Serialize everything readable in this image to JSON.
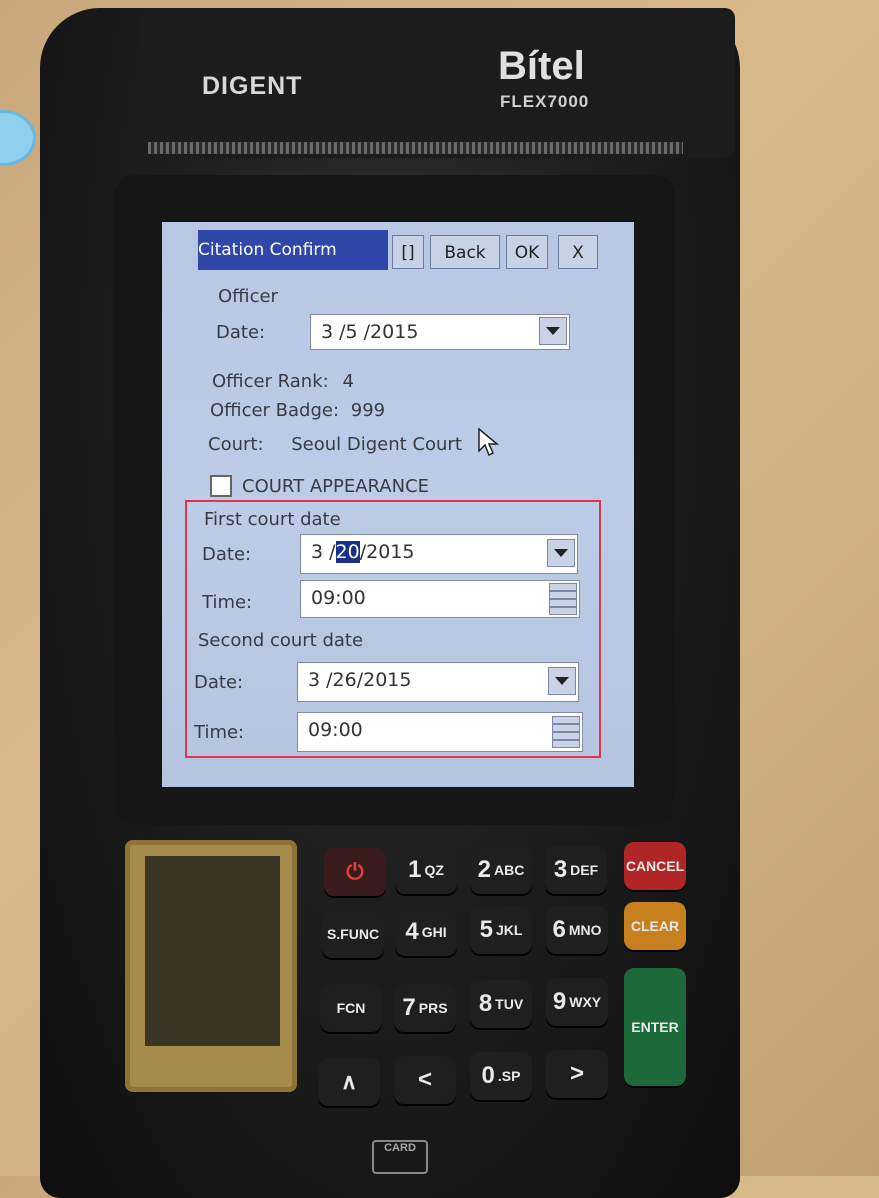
{
  "device": {
    "brand_left": "DIGENT",
    "brand_right": "Bítel",
    "model": "FLEX7000",
    "card_slot_label": "CARD"
  },
  "window": {
    "title": "Citation Confirm",
    "buttons": {
      "keyboard": "[]",
      "back": "Back",
      "ok": "OK",
      "close": "X"
    }
  },
  "officer": {
    "section_label": "Officer",
    "date_label": "Date:",
    "date_value": "3 /5 /2015",
    "rank_label": "Officer Rank:",
    "rank_value": "4",
    "badge_label": "Officer Badge:",
    "badge_value": "999",
    "court_label": "Court:",
    "court_value": "Seoul Digent Court"
  },
  "court_appearance": {
    "label": "COURT APPEARANCE",
    "checked": false
  },
  "first_court_date": {
    "section_label": "First court date",
    "date_label": "Date:",
    "date_prefix": "3 /",
    "date_selected": "20",
    "date_suffix": "/2015",
    "time_label": "Time:",
    "time_value": "09:00"
  },
  "second_court_date": {
    "section_label": "Second court date",
    "date_label": "Date:",
    "date_value": "3 /26/2015",
    "time_label": "Time:",
    "time_value": "09:00"
  },
  "keypad": {
    "power": "⏻",
    "k1": "1",
    "k1s": "QZ",
    "k2": "2",
    "k2s": "ABC",
    "k3": "3",
    "k3s": "DEF",
    "cancel": "CANCEL",
    "sfunc": "S.FUNC",
    "k4": "4",
    "k4s": "GHI",
    "k5": "5",
    "k5s": "JKL",
    "k6": "6",
    "k6s": "MNO",
    "clear": "CLEAR",
    "fcn": "FCN",
    "k7": "7",
    "k7s": "PRS",
    "k8": "8",
    "k8s": "TUV",
    "k9": "9",
    "k9s": "WXY",
    "enter": "ENTER",
    "up": "∧",
    "left": "<",
    "k0": "0",
    "k0s": ".SP",
    "right": ">"
  },
  "colors": {
    "title_bar": "#2e47a8",
    "screen_bg": "#b8c8e4",
    "highlight_box": "#e0354d",
    "cancel": "#b02626",
    "clear": "#c6801e",
    "enter": "#1c6a3a"
  }
}
